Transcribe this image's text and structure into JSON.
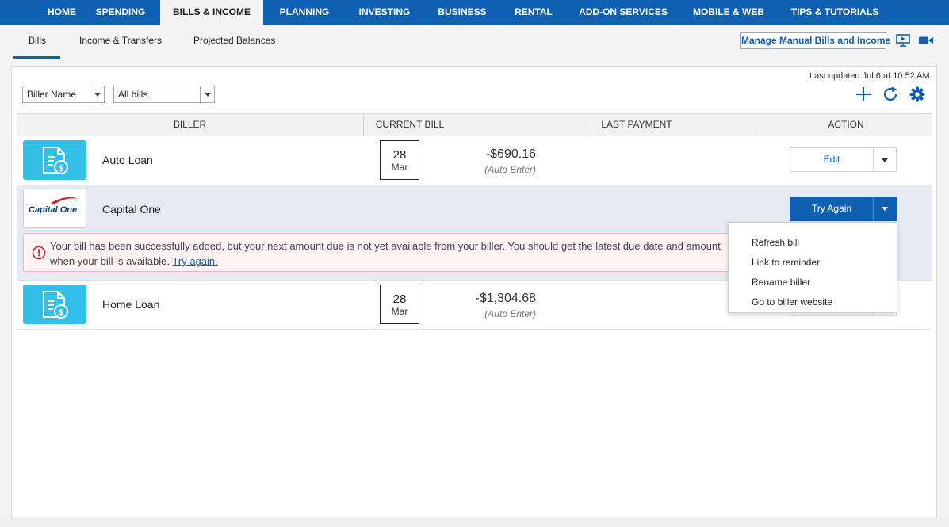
{
  "nav": {
    "items": [
      {
        "label": "HOME"
      },
      {
        "label": "SPENDING"
      },
      {
        "label": "BILLS & INCOME"
      },
      {
        "label": "PLANNING"
      },
      {
        "label": "INVESTING"
      },
      {
        "label": "BUSINESS"
      },
      {
        "label": "RENTAL"
      },
      {
        "label": "ADD-ON SERVICES"
      },
      {
        "label": "MOBILE & WEB"
      },
      {
        "label": "TIPS & TUTORIALS"
      }
    ],
    "active": "BILLS & INCOME",
    "color": "#0f5fb3"
  },
  "subnav": {
    "tabs": [
      {
        "label": "Bills"
      },
      {
        "label": "Income & Transfers"
      },
      {
        "label": "Projected Balances"
      }
    ],
    "active": "Bills",
    "manage_label": "Manage Manual Bills and Income",
    "icons": [
      "presentation-icon",
      "video-camera-icon"
    ]
  },
  "panel": {
    "last_updated": "Last updated Jul 6 at 10:52 AM",
    "filters": {
      "biller_name": "Biller Name",
      "all_bills": "All bills"
    },
    "tool_icons": [
      "add-icon",
      "refresh-icon",
      "gear-icon"
    ]
  },
  "table": {
    "headers": {
      "biller": "BILLER",
      "current_bill": "CURRENT BILL",
      "last_payment": "LAST PAYMENT",
      "action": "ACTION"
    },
    "rows": [
      {
        "name": "Auto Loan",
        "day": "28",
        "month": "Mar",
        "amount": "-$690.16",
        "note": "(Auto Enter)",
        "action": "Edit"
      },
      {
        "name": "Capital One",
        "logo_text": "Capital One",
        "action": "Try Again",
        "alert_text": "Your bill has been successfully added, but your next amount due is not yet available from your biller. You should get the latest due date and amount when your bill is available.",
        "alert_link": "Try again."
      },
      {
        "name": "Home Loan",
        "day": "28",
        "month": "Mar",
        "amount": "-$1,304.68",
        "note": "(Auto Enter)"
      }
    ]
  },
  "dropdown": {
    "items": [
      {
        "label": "Refresh bill"
      },
      {
        "label": "Link to reminder"
      },
      {
        "label": "Rename biller"
      },
      {
        "label": "Go to biller website"
      }
    ]
  }
}
